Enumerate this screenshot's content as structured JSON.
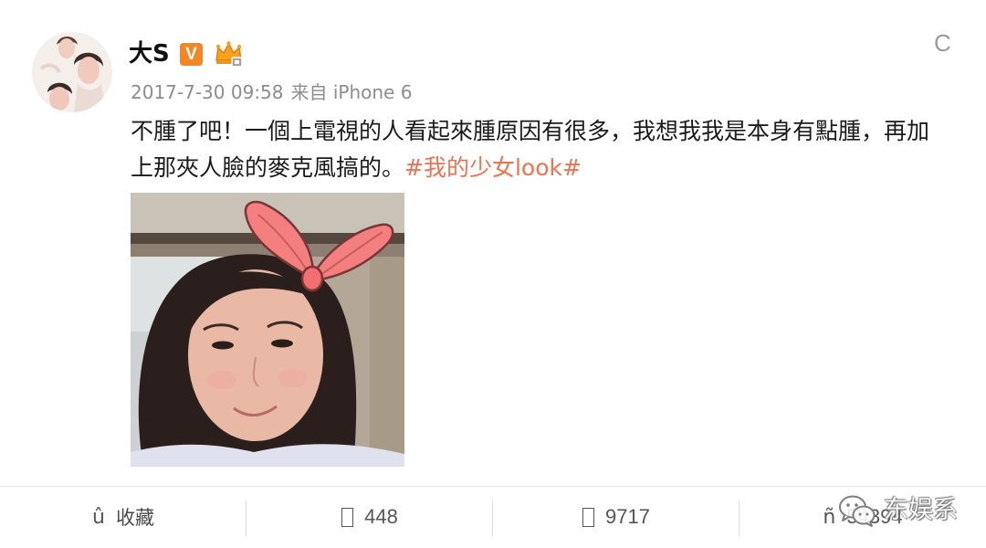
{
  "user": {
    "name": "大S",
    "verified_label": "V",
    "verified_icon": "verified-v-icon",
    "member_icon": "crown-member-icon"
  },
  "header": {
    "menu_glyph": "C",
    "menu_icon": "dropdown-menu-icon"
  },
  "post": {
    "time": "2017-7-30 09:58",
    "source": "来自 iPhone 6",
    "text": "不腫了吧！一個上電視的人看起來腫原因有很多，我想我我是本身有點腫，再加上那夾人臉的麥克風搞的。",
    "hashtag": "#我的少女look#"
  },
  "actions": [
    {
      "icon": "favorite-icon",
      "glyph": "û",
      "label": "收藏"
    },
    {
      "icon": "repost-icon",
      "label": "448"
    },
    {
      "icon": "comment-icon",
      "label": "9717"
    },
    {
      "icon": "like-icon",
      "glyph": "ñ",
      "label": "54394"
    }
  ],
  "watermark": {
    "icon": "wechat-logo-icon",
    "text": "东娱系"
  },
  "colors": {
    "hashtag": "#eb7350",
    "badge": "#f6861f",
    "meta": "#8c8c8c",
    "divider": "#e6e6e6"
  }
}
